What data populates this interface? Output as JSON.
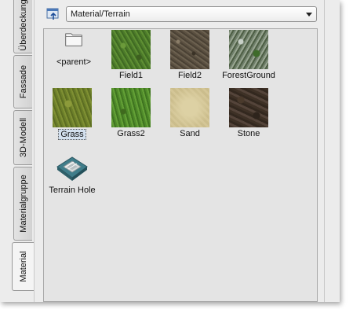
{
  "tabs": [
    {
      "label": "Überdeckung",
      "active": false
    },
    {
      "label": "Fassade",
      "active": false
    },
    {
      "label": "3D-Modell",
      "active": false
    },
    {
      "label": "Materialgruppe",
      "active": false
    },
    {
      "label": "Material",
      "active": true
    }
  ],
  "toolbar": {
    "nav_icon": "folder-up-icon",
    "path": "Material/Terrain"
  },
  "items": [
    {
      "label": "<parent>",
      "icon": "folder-icon"
    },
    {
      "label": "Field1",
      "icon": "texture-thumbnail"
    },
    {
      "label": "Field2",
      "icon": "texture-thumbnail"
    },
    {
      "label": "ForestGround",
      "icon": "texture-thumbnail"
    },
    {
      "label": "Grass",
      "icon": "texture-thumbnail",
      "selected": true
    },
    {
      "label": "Grass2",
      "icon": "texture-thumbnail"
    },
    {
      "label": "Sand",
      "icon": "texture-thumbnail"
    },
    {
      "label": "Stone",
      "icon": "texture-thumbnail"
    },
    {
      "label": "Terrain Hole",
      "icon": "terrain-hole-icon"
    }
  ]
}
